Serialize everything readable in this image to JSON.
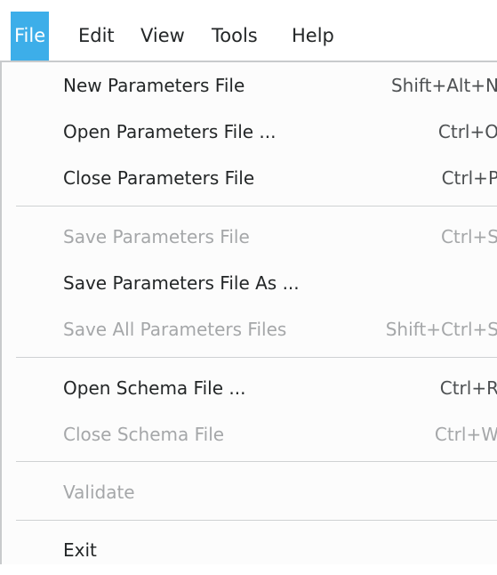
{
  "menubar": {
    "items": [
      {
        "label": "File",
        "active": true
      },
      {
        "label": "Edit",
        "active": false
      },
      {
        "label": "View",
        "active": false
      },
      {
        "label": "Tools",
        "active": false
      },
      {
        "label": "Help",
        "active": false
      }
    ]
  },
  "file_menu": {
    "items": [
      {
        "label": "New Parameters File",
        "shortcut": "Shift+Alt+N",
        "enabled": true
      },
      {
        "label": "Open Parameters File ...",
        "shortcut": "Ctrl+O",
        "enabled": true
      },
      {
        "label": "Close Parameters File",
        "shortcut": "Ctrl+P",
        "enabled": true
      },
      {
        "label": "Save Parameters File",
        "shortcut": "Ctrl+S",
        "enabled": false
      },
      {
        "label": "Save Parameters File As ...",
        "shortcut": "",
        "enabled": true
      },
      {
        "label": "Save All Parameters Files",
        "shortcut": "Shift+Ctrl+S",
        "enabled": false
      },
      {
        "label": "Open Schema File ...",
        "shortcut": "Ctrl+R",
        "enabled": true
      },
      {
        "label": "Close Schema File",
        "shortcut": "Ctrl+W",
        "enabled": false
      },
      {
        "label": "Validate",
        "shortcut": "",
        "enabled": false
      },
      {
        "label": "Exit",
        "shortcut": "",
        "enabled": true
      }
    ]
  },
  "colors": {
    "accent": "#3daee9",
    "text": "#232627",
    "disabled_text": "#a5a7a9",
    "separator": "#cfd1d3"
  }
}
